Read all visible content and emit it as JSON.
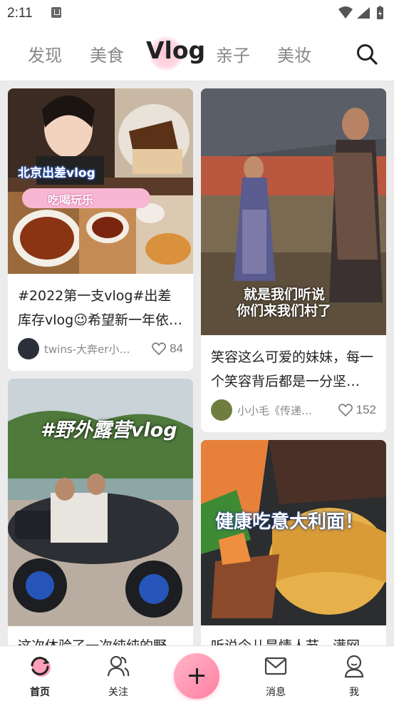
{
  "status_bar": {
    "time": "2:11"
  },
  "top_tabs": [
    {
      "label": "发现"
    },
    {
      "label": "美食"
    },
    {
      "label": "Vlog",
      "active": true
    },
    {
      "label": "亲子"
    },
    {
      "label": "美妆"
    }
  ],
  "feed": {
    "cards": [
      {
        "overlay": [
          "北京出差vlog",
          "吃喝玩乐"
        ],
        "title": "#2022第一支vlog#出差库存vlog😉希望新一年依…",
        "author": "twins-大奔er小…",
        "likes": "84"
      },
      {
        "overlay": [
          "就是我们听说",
          "你们来我们村了"
        ],
        "title": "笑容这么可爱的妹妹，每一个笑容背后都是一分坚…",
        "author": "小小毛《传递…",
        "likes": "152"
      },
      {
        "overlay": [
          "#野外露营vlog"
        ],
        "title": "这次体验了一次纯纯的野…"
      },
      {
        "overlay": [
          "健康吃意大利面！"
        ],
        "title": "听说今儿是情人节，满网…"
      }
    ]
  },
  "bottom_nav": {
    "items": [
      {
        "label": "首页",
        "icon": "home-refresh-icon",
        "active": true
      },
      {
        "label": "关注",
        "icon": "follow-people-icon"
      },
      {
        "label": "",
        "icon": "plus-icon"
      },
      {
        "label": "消息",
        "icon": "message-envelope-icon"
      },
      {
        "label": "我",
        "icon": "profile-icon"
      }
    ]
  },
  "colors": {
    "accent_pink": "#ff7ea1",
    "background": "#ebebeb"
  }
}
